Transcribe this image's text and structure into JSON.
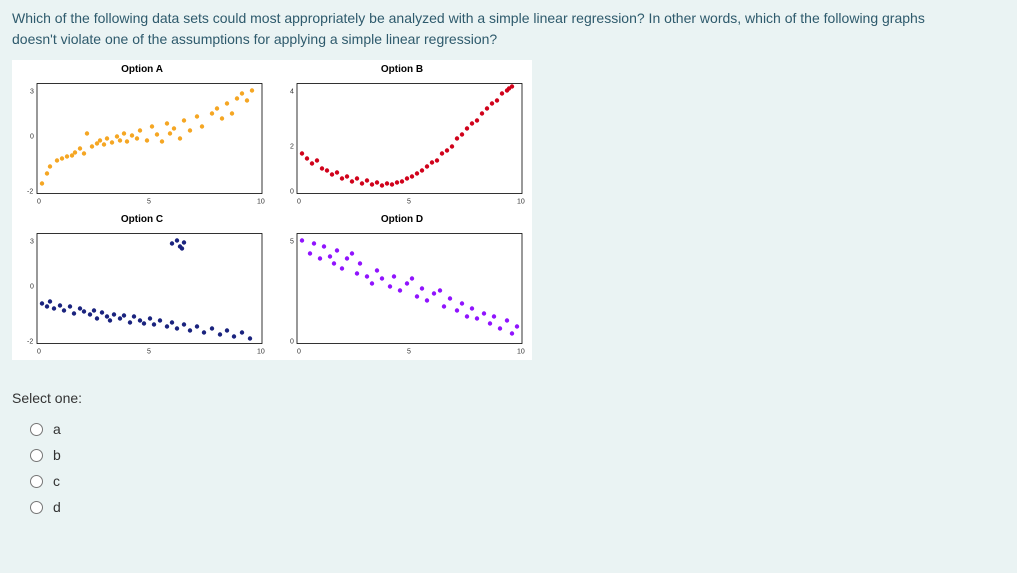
{
  "question": {
    "line1": "Which of the following data sets could most appropriately be analyzed with a simple linear regression? In other words, which of the following graphs",
    "line2": "doesn't violate one of the assumptions for applying a simple linear regression?"
  },
  "charts": {
    "a": {
      "title": "Option A",
      "color": "#f5a623"
    },
    "b": {
      "title": "Option B",
      "color": "#d0021b"
    },
    "c": {
      "title": "Option C",
      "color": "#1a237e"
    },
    "d": {
      "title": "Option D",
      "color": "#9013fe"
    }
  },
  "chart_data": [
    {
      "type": "scatter",
      "title": "Option A",
      "description": "upward linear trend with increasing variance (heteroscedastic fan shape)",
      "x_range": [
        0,
        10
      ],
      "y_range": [
        -2,
        3
      ],
      "color": "orange"
    },
    {
      "type": "scatter",
      "title": "Option B",
      "description": "U-shaped / quadratic curve (nonlinear relationship)",
      "x_range": [
        0,
        10
      ],
      "y_range": [
        0,
        4
      ],
      "color": "red"
    },
    {
      "type": "scatter",
      "title": "Option C",
      "description": "downward linear trend with a cluster of outliers at top",
      "x_range": [
        0,
        10
      ],
      "y_range": [
        -2,
        3
      ],
      "color": "dark blue"
    },
    {
      "type": "scatter",
      "title": "Option D",
      "description": "downward linear trend, roughly constant variance (meets assumptions)",
      "x_range": [
        0,
        10
      ],
      "y_range": [
        0,
        5
      ],
      "color": "purple"
    }
  ],
  "answer": {
    "select_label": "Select one:",
    "options": [
      {
        "id": "a",
        "label": "a"
      },
      {
        "id": "b",
        "label": "b"
      },
      {
        "id": "c",
        "label": "c"
      },
      {
        "id": "d",
        "label": "d"
      }
    ]
  }
}
